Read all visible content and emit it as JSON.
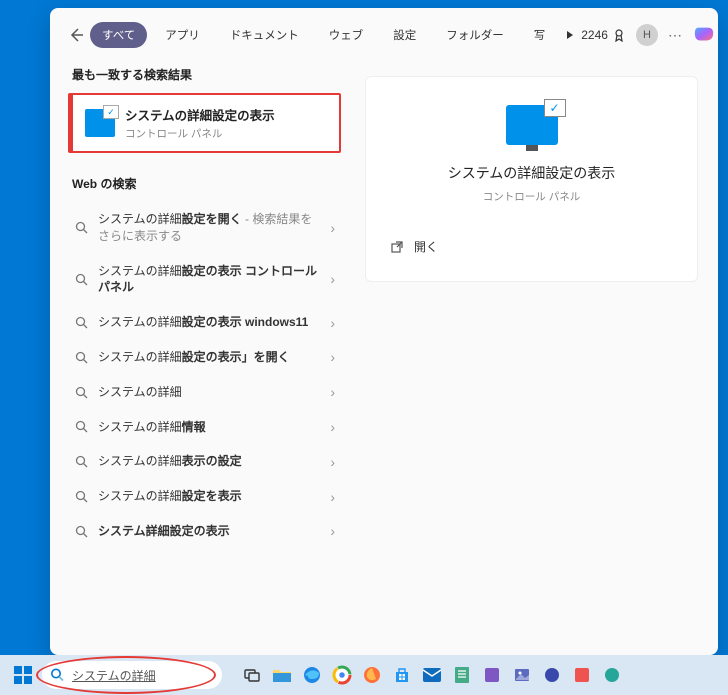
{
  "tabs": {
    "all": "すべて",
    "apps": "アプリ",
    "documents": "ドキュメント",
    "web": "ウェブ",
    "settings": "設定",
    "folders": "フォルダー",
    "photos": "写"
  },
  "topRight": {
    "points": "2246",
    "avatar": "H"
  },
  "bestMatch": {
    "header": "最も一致する検索結果",
    "title": "システムの詳細設定の表示",
    "subtitle": "コントロール パネル"
  },
  "webSearch": {
    "header": "Web の検索",
    "items": [
      {
        "prefix": "システムの詳細",
        "bold": "設定を開く",
        "suffix": "",
        "sub": " - 検索結果をさらに表示する"
      },
      {
        "prefix": "システムの詳細",
        "bold": "設定の表示 コントロールパネル",
        "suffix": "",
        "sub": ""
      },
      {
        "prefix": "システムの詳細",
        "bold": "設定の表示 windows11",
        "suffix": "",
        "sub": ""
      },
      {
        "prefix": "システムの詳細",
        "bold": "設定の表示」を開く",
        "suffix": "",
        "sub": ""
      },
      {
        "prefix": "システムの詳細",
        "bold": "",
        "suffix": "",
        "sub": ""
      },
      {
        "prefix": "システムの詳細",
        "bold": "情報",
        "suffix": "",
        "sub": ""
      },
      {
        "prefix": "システムの詳細",
        "bold": "表示の設定",
        "suffix": "",
        "sub": ""
      },
      {
        "prefix": "システムの詳細",
        "bold": "設定を表示",
        "suffix": "",
        "sub": ""
      },
      {
        "prefix": "",
        "bold": "システム詳細設定の表示",
        "suffix": "",
        "sub": ""
      }
    ]
  },
  "detail": {
    "title": "システムの詳細設定の表示",
    "subtitle": "コントロール パネル",
    "open": "開く"
  },
  "searchInput": "システムの詳細"
}
